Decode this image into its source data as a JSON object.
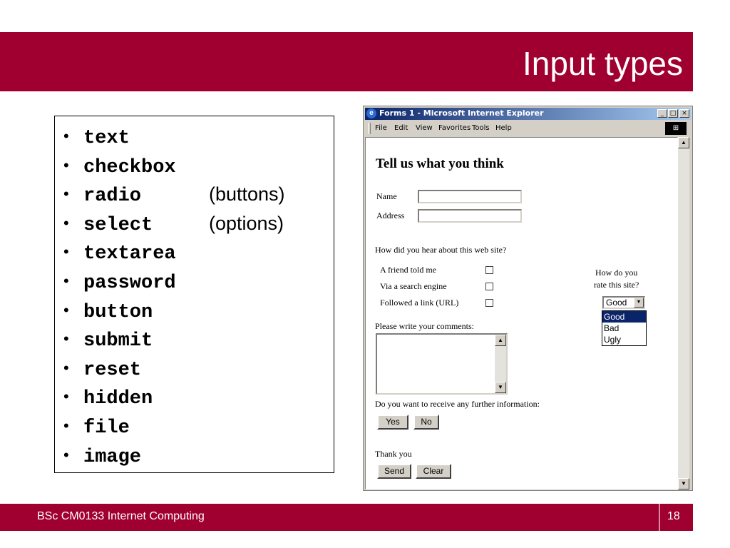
{
  "slide": {
    "title": "Input types",
    "footer": "BSc CM0133 Internet Computing",
    "page_number": "18",
    "accent_color": "#a00030"
  },
  "bullets": [
    {
      "code": "text",
      "note": ""
    },
    {
      "code": "checkbox",
      "note": ""
    },
    {
      "code": "radio",
      "note": "(buttons)"
    },
    {
      "code": "select",
      "note": "(options)"
    },
    {
      "code": "textarea",
      "note": ""
    },
    {
      "code": "password",
      "note": ""
    },
    {
      "code": "button",
      "note": ""
    },
    {
      "code": "submit",
      "note": ""
    },
    {
      "code": "reset",
      "note": ""
    },
    {
      "code": "hidden",
      "note": ""
    },
    {
      "code": "file",
      "note": ""
    },
    {
      "code": "image",
      "note": ""
    }
  ],
  "browser": {
    "title": "Forms 1 - Microsoft Internet Explorer",
    "menu": [
      "File",
      "Edit",
      "View",
      "Favorites",
      "Tools",
      "Help"
    ],
    "window_controls": {
      "minimize": "_",
      "maximize": "□",
      "close": "×"
    },
    "icons": [
      "ie-app-icon",
      "windows-logo-icon",
      "scroll-up-arrow-icon",
      "scroll-down-arrow-icon"
    ]
  },
  "form": {
    "heading": "Tell us what you think",
    "name_label": "Name",
    "address_label": "Address",
    "name_value": "",
    "address_value": "",
    "question": "How did you hear about this web site?",
    "options": [
      {
        "label": "A friend told me",
        "checked": false
      },
      {
        "label": "Via a search engine",
        "checked": false
      },
      {
        "label": "Followed a link (URL)",
        "checked": false
      }
    ],
    "rate_label_1": "How do you",
    "rate_label_2": "rate this site?",
    "rate_selected": "Good",
    "rate_options": [
      "Good",
      "Bad",
      "Ugly"
    ],
    "comments_label": "Please write your comments:",
    "comments_value": "",
    "info_question": "Do you want to receive any further information:",
    "yes_label": "Yes",
    "no_label": "No",
    "thanks": "Thank you",
    "send_label": "Send",
    "clear_label": "Clear"
  }
}
